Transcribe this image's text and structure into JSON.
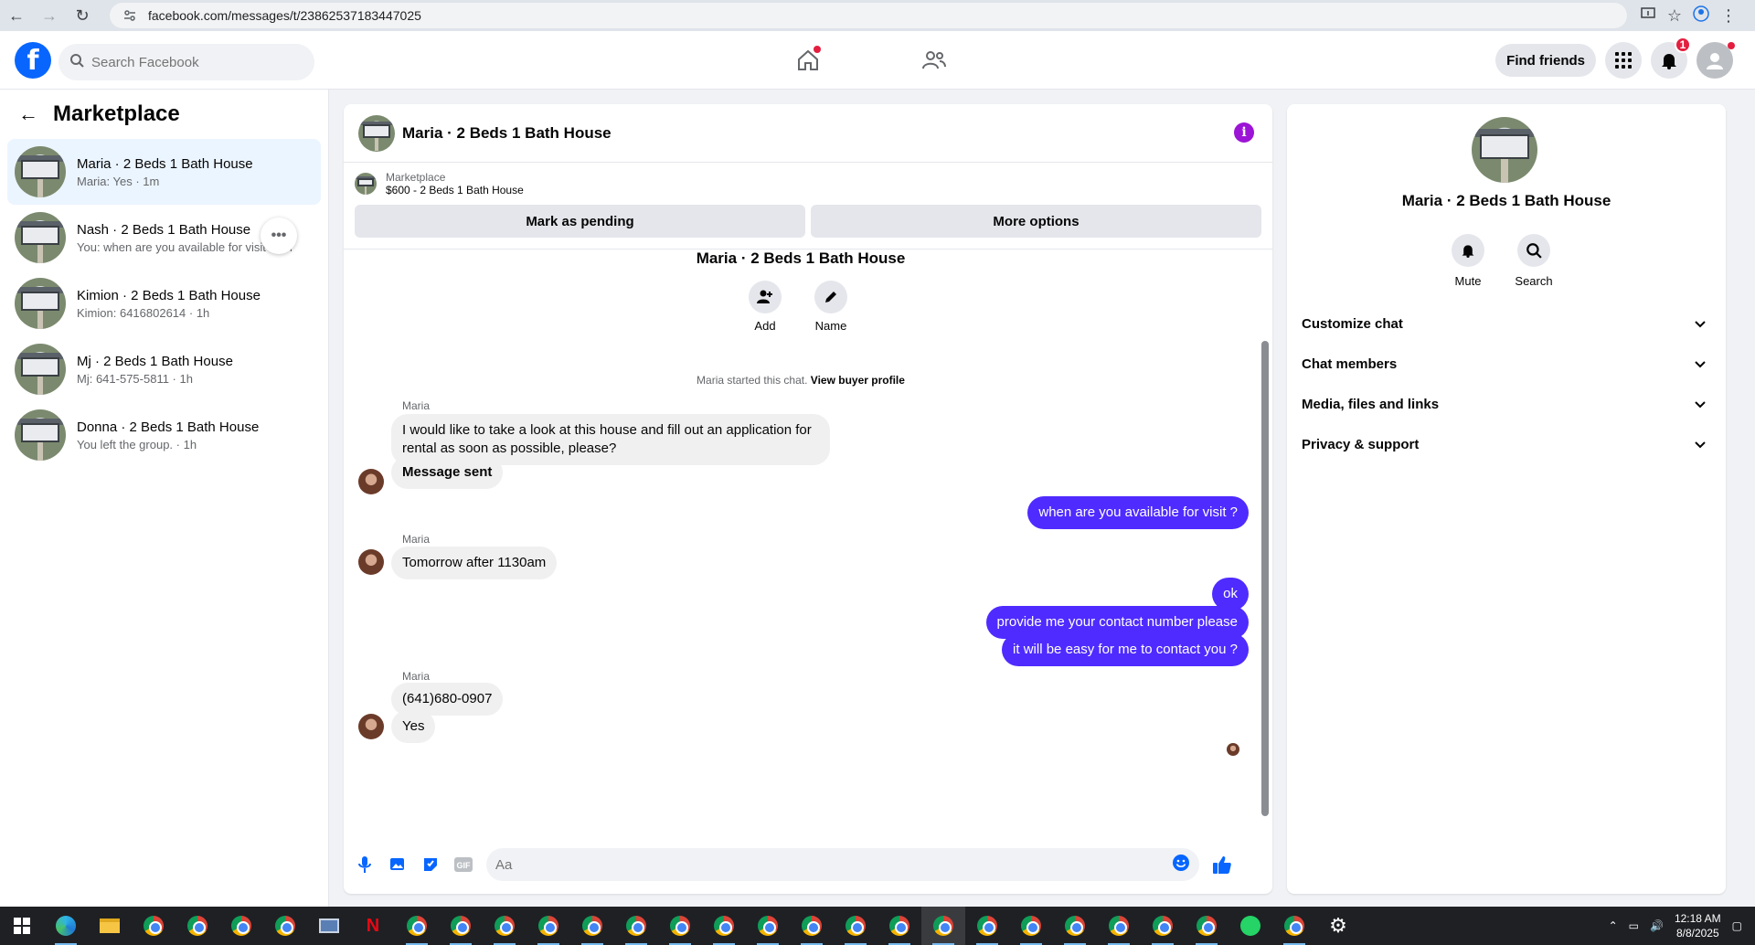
{
  "browser": {
    "url": "facebook.com/messages/t/23862537183447025"
  },
  "header": {
    "search_placeholder": "Search Facebook",
    "find_friends": "Find friends",
    "notifications_count": "1"
  },
  "sidebar": {
    "title": "Marketplace",
    "conversations": [
      {
        "name": "Maria · 2 Beds 1 Bath House",
        "preview": "Maria: Yes · 1m"
      },
      {
        "name": "Nash · 2 Beds 1 Bath House",
        "preview": "You: when are you available for visit ... m"
      },
      {
        "name": "Kimion · 2 Beds 1 Bath House",
        "preview": "Kimion: 6416802614 · 1h"
      },
      {
        "name": "Mj · 2 Beds 1 Bath House",
        "preview": "Mj: 641-575-5811 · 1h"
      },
      {
        "name": "Donna · 2 Beds 1 Bath House",
        "preview": "You left the group. · 1h"
      }
    ]
  },
  "chat": {
    "title": "Maria · 2 Beds 1 Bath House",
    "listing_source": "Marketplace",
    "listing_title": "$600 - 2 Beds 1 Bath House",
    "mark_pending": "Mark as pending",
    "more_options": "More options",
    "group_title": "Maria · 2 Beds 1 Bath House",
    "add_label": "Add",
    "name_label": "Name",
    "started_text": "Maria started this chat.",
    "view_profile": "View buyer profile",
    "sender_name": "Maria",
    "messages": {
      "m1": "I would like to take a look at this house and fill out an application for rental as soon as possible, please?",
      "m2": "Message sent",
      "m3": "when are you available for visit ?",
      "m4": "Tomorrow after 1130am",
      "m5": "ok",
      "m6": "provide me your contact number please",
      "m7": "it will be easy for me to contact you ?",
      "m8": "(641)680-0907",
      "m9": "Yes"
    },
    "composer_placeholder": "Aa"
  },
  "info_panel": {
    "name": "Maria · 2 Beds 1 Bath House",
    "mute": "Mute",
    "search": "Search",
    "sections": [
      "Customize chat",
      "Chat members",
      "Media, files and links",
      "Privacy & support"
    ]
  },
  "taskbar": {
    "time": "12:18 AM",
    "date": "8/8/2025"
  },
  "colors": {
    "accent": "#0866ff",
    "outgoing_bubble": "#4f2bff",
    "info_icon": "#9c14d6",
    "badge": "#e41e3f"
  }
}
